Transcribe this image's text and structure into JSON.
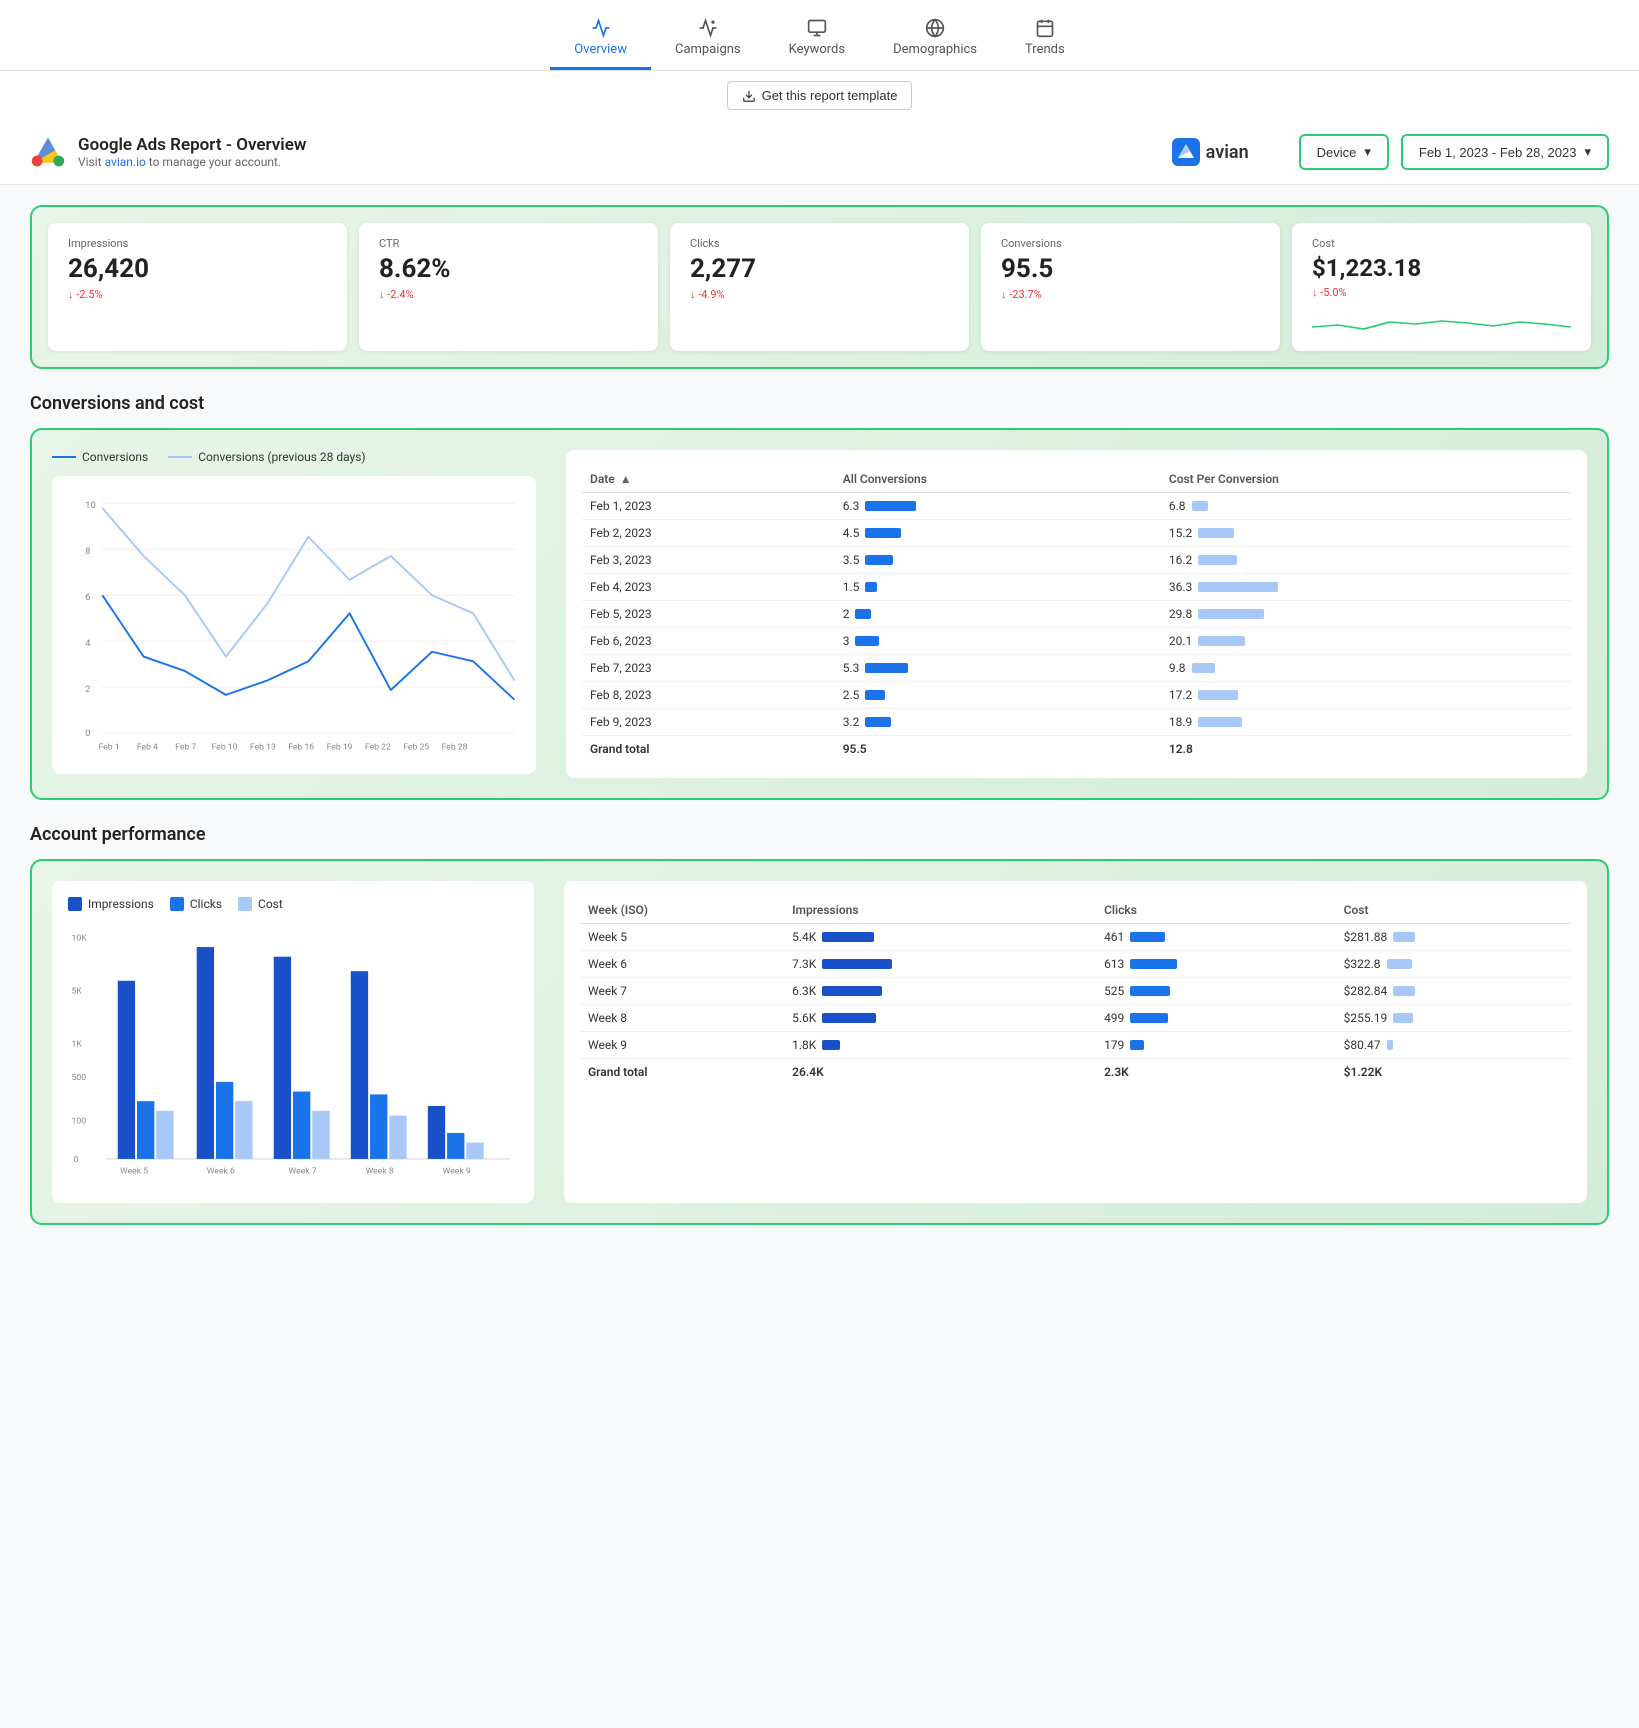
{
  "nav": {
    "items": [
      {
        "id": "overview",
        "label": "Overview",
        "active": true
      },
      {
        "id": "campaigns",
        "label": "Campaigns",
        "active": false
      },
      {
        "id": "keywords",
        "label": "Keywords",
        "active": false
      },
      {
        "id": "demographics",
        "label": "Demographics",
        "active": false
      },
      {
        "id": "trends",
        "label": "Trends",
        "active": false
      }
    ]
  },
  "template_btn": "Get this report template",
  "header": {
    "title": "Google Ads Report - Overview",
    "subtitle_prefix": "Visit ",
    "subtitle_link": "avian.io",
    "subtitle_suffix": " to manage your account.",
    "avian_label": "avian",
    "device_label": "Device",
    "date_range": "Feb 1, 2023 - Feb 28, 2023"
  },
  "metrics": [
    {
      "label": "Impressions",
      "value": "26,420",
      "change": "↓ -2.5%"
    },
    {
      "label": "CTR",
      "value": "8.62%",
      "change": "↓ -2.4%"
    },
    {
      "label": "Clicks",
      "value": "2,277",
      "change": "↓ -4.9%"
    },
    {
      "label": "Conversions",
      "value": "95.5",
      "change": "↓ -23.7%"
    },
    {
      "label": "Cost",
      "value": "$1,223.18",
      "change": "↓ -5.0%"
    }
  ],
  "conversions_section": {
    "title": "Conversions and cost",
    "legend": [
      {
        "label": "Conversions",
        "style": "dark"
      },
      {
        "label": "Conversions (previous 28 days)",
        "style": "light"
      }
    ],
    "x_labels": [
      "Feb 1",
      "Feb 4",
      "Feb 7",
      "Feb 10",
      "Feb 13",
      "Feb 16",
      "Feb 19",
      "Feb 22",
      "Feb 25",
      "Feb 28"
    ],
    "y_labels": [
      "0",
      "2",
      "4",
      "6",
      "8",
      "10"
    ],
    "table": {
      "columns": [
        "Date ▲",
        "All Conversions",
        "Cost Per Conversion"
      ],
      "rows": [
        {
          "date": "Feb 1, 2023",
          "conversions": "6.3",
          "conv_bar": 63,
          "cost": "6.8",
          "cost_bar": 20
        },
        {
          "date": "Feb 2, 2023",
          "conversions": "4.5",
          "conv_bar": 45,
          "cost": "15.2",
          "cost_bar": 45
        },
        {
          "date": "Feb 3, 2023",
          "conversions": "3.5",
          "conv_bar": 35,
          "cost": "16.2",
          "cost_bar": 48
        },
        {
          "date": "Feb 4, 2023",
          "conversions": "1.5",
          "conv_bar": 15,
          "cost": "36.3",
          "cost_bar": 100
        },
        {
          "date": "Feb 5, 2023",
          "conversions": "2",
          "conv_bar": 20,
          "cost": "29.8",
          "cost_bar": 82
        },
        {
          "date": "Feb 6, 2023",
          "conversions": "3",
          "conv_bar": 30,
          "cost": "20.1",
          "cost_bar": 58
        },
        {
          "date": "Feb 7, 2023",
          "conversions": "5.3",
          "conv_bar": 53,
          "cost": "9.8",
          "cost_bar": 29
        },
        {
          "date": "Feb 8, 2023",
          "conversions": "2.5",
          "conv_bar": 25,
          "cost": "17.2",
          "cost_bar": 50
        },
        {
          "date": "Feb 9, 2023",
          "conversions": "3.2",
          "conv_bar": 32,
          "cost": "18.9",
          "cost_bar": 55
        }
      ],
      "total_label": "Grand total",
      "total_conversions": "95.5",
      "total_cost": "12.8"
    }
  },
  "performance_section": {
    "title": "Account performance",
    "legend": [
      {
        "label": "Impressions",
        "style": "dark-blue"
      },
      {
        "label": "Clicks",
        "style": "mid-blue"
      },
      {
        "label": "Cost",
        "style": "light-blue"
      }
    ],
    "x_labels": [
      "Week 5",
      "Week 6",
      "Week 7",
      "Week 8",
      "Week 9"
    ],
    "y_labels": [
      "10K",
      "5K",
      "1K",
      "500",
      "100",
      "0"
    ],
    "table": {
      "columns": [
        "Week (ISO)",
        "Impressions",
        "Clicks",
        "Cost"
      ],
      "rows": [
        {
          "week": "Week 5",
          "impressions": "5.4K",
          "imp_bar": 74,
          "clicks": "461",
          "clk_bar": 70,
          "cost": "$281.88",
          "cost_bar": 55
        },
        {
          "week": "Week 6",
          "impressions": "7.3K",
          "imp_bar": 100,
          "clicks": "613",
          "clk_bar": 94,
          "cost": "$322.8",
          "cost_bar": 63
        },
        {
          "week": "Week 7",
          "impressions": "6.3K",
          "imp_bar": 86,
          "clicks": "525",
          "clk_bar": 80,
          "cost": "$282.84",
          "cost_bar": 55
        },
        {
          "week": "Week 8",
          "impressions": "5.6K",
          "imp_bar": 77,
          "clicks": "499",
          "clk_bar": 76,
          "cost": "$255.19",
          "cost_bar": 50
        },
        {
          "week": "Week 9",
          "impressions": "1.8K",
          "imp_bar": 25,
          "clicks": "179",
          "clk_bar": 27,
          "cost": "$80.47",
          "cost_bar": 16
        }
      ],
      "total_label": "Grand total",
      "total_impressions": "26.4K",
      "total_clicks": "2.3K",
      "total_cost": "$1.22K"
    }
  }
}
